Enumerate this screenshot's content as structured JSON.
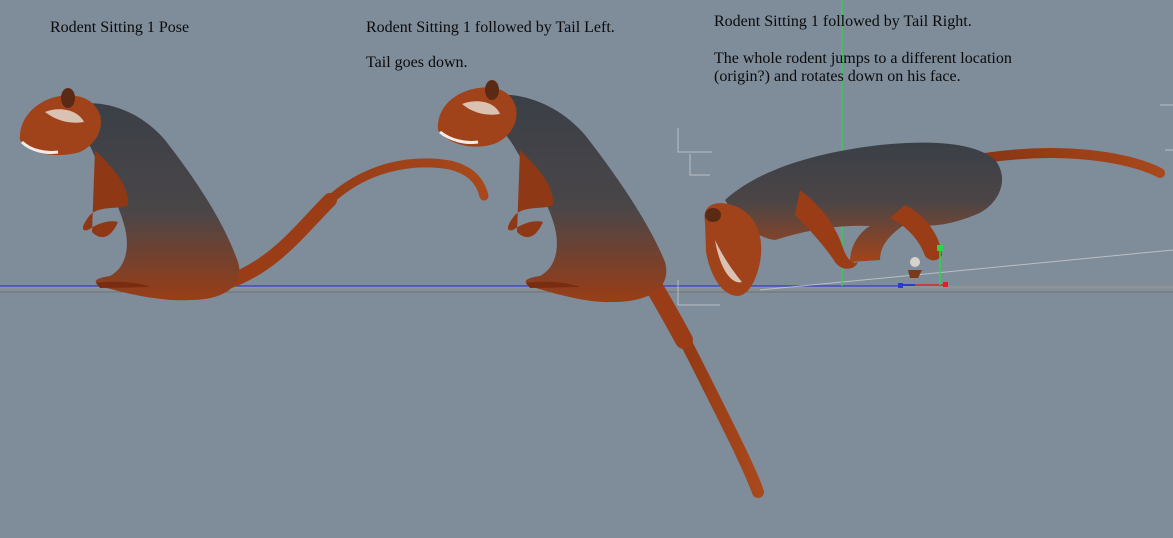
{
  "panels": [
    {
      "title": "Rodent Sitting 1 Pose",
      "note_lines": []
    },
    {
      "title": "Rodent Sitting 1 followed by Tail Left.",
      "note_lines": [
        "Tail goes down."
      ]
    },
    {
      "title": "Rodent Sitting 1 followed by Tail Right.",
      "note_lines": [
        "The whole rodent jumps to a different location",
        "(origin?) and rotates down on his face."
      ]
    }
  ],
  "colors": {
    "background": "#7f8c9a",
    "ground_plane": "#8a8a8a",
    "x_axis": "#2233cc",
    "y_axis": "#22dd44",
    "fur_orange": "#9a3d16",
    "fur_dark": "#3b4048",
    "gizmo_red": "#e02020"
  }
}
